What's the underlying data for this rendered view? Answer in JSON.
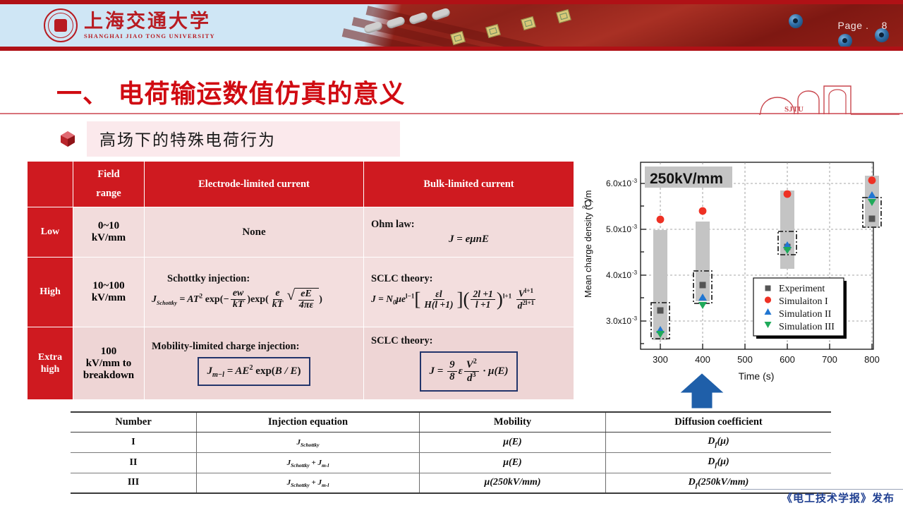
{
  "header": {
    "logo_cn": "上海交通大学",
    "logo_en": "SHANGHAI JIAO TONG UNIVERSITY",
    "page_label": "Page .",
    "page_number": "8",
    "accent_red": "#b01116"
  },
  "title": {
    "heading": "一、 电荷输运数值仿真的意义",
    "subheading": "高场下的特殊电荷行为",
    "arch_word": "SJTU"
  },
  "main_table": {
    "headers": [
      "",
      "Field\nrange",
      "Electrode-limited current",
      "Bulk-limited current"
    ],
    "header_field_line1": "Field",
    "header_field_line2": "range",
    "header_electrode": "Electrode-limited current",
    "header_bulk": "Bulk-limited current",
    "rows": [
      {
        "level": "Low",
        "range": "0~10\nkV/mm",
        "range_line1": "0~10",
        "range_line2": "kV/mm",
        "electrode_caption": "",
        "electrode_text": "None",
        "bulk_caption": "Ohm law:",
        "bulk_formula": "J = eμnE"
      },
      {
        "level": "High",
        "range_line1": "10~100",
        "range_line2": "kV/mm",
        "electrode_caption": "Schottky injection:",
        "electrode_formula": "J_Schottky = AT² exp(−ew/kT) exp((e/kT)√(eE/4πε))",
        "bulk_caption": "SCLC theory:",
        "bulk_formula": "J = N₀μe^(l−1) [ εl / (H(l+1)) ] ( (2l+1)/(l+1) )^(l+1) V^(l+1) / d^(2l+1)"
      },
      {
        "level_line1": "Extra",
        "level_line2": "high",
        "range_line1": "100",
        "range_line2": "kV/mm to",
        "range_line3": "breakdown",
        "electrode_caption": "Mobility-limited charge injection:",
        "electrode_formula": "J_m−l = AE² exp(B / E)",
        "bulk_caption": "SCLC theory:",
        "bulk_formula": "J = (9/8) ε V²/d³ · μ(E)"
      }
    ]
  },
  "bottom_table": {
    "headers": [
      "Number",
      "Injection equation",
      "Mobility",
      "Diffusion coefficient"
    ],
    "rows": [
      {
        "number": "I",
        "injection": "J_Schottky",
        "mobility": "μ(E)",
        "diffusion": "D_f(μ)"
      },
      {
        "number": "II",
        "injection": "J_Schottky + J_m-l",
        "mobility": "μ(E)",
        "diffusion": "D_f(μ)"
      },
      {
        "number": "III",
        "injection": "J_Schottky + J_m-l",
        "mobility": "μ(250kV/mm)",
        "diffusion": "D_f(250kV/mm)"
      }
    ]
  },
  "chart_data": {
    "type": "scatter",
    "title": "",
    "annotation": "250kV/mm",
    "xlabel": "Time (s)",
    "ylabel": "Mean charge density (C/m³)",
    "xlim": [
      250,
      860
    ],
    "ylim": [
      0.0024,
      0.0064
    ],
    "xticks": [
      300,
      400,
      500,
      600,
      700,
      800
    ],
    "xtick_labels": [
      "300",
      "400",
      "500",
      "600",
      "700",
      "800"
    ],
    "yticks": [
      0.003,
      0.004,
      0.005,
      0.006
    ],
    "ytick_labels": [
      "3.0x10-3",
      "4.0x10-3",
      "5.0x10-3",
      "6.0x10-3"
    ],
    "grid": true,
    "legend_position": "lower right",
    "x": [
      300,
      400,
      600,
      800
    ],
    "series": [
      {
        "name": "Experiment",
        "marker": "square",
        "color": "#555555",
        "values": [
          0.00335,
          0.0039,
          0.00473,
          0.00535
        ]
      },
      {
        "name": "Simulaiton I",
        "marker": "circle",
        "color": "#ee3124",
        "values": [
          0.00522,
          0.00541,
          0.00578,
          0.00608
        ]
      },
      {
        "name": "Simulation II",
        "marker": "triangle-up",
        "color": "#2176d2",
        "values": [
          0.0029,
          0.0036,
          0.00474,
          0.00583
        ]
      },
      {
        "name": "Simulation III",
        "marker": "triangle-down",
        "color": "#1faa5a",
        "values": [
          0.00272,
          0.00342,
          0.00459,
          0.00571
        ]
      }
    ],
    "shaded_bands": [
      {
        "x": 300,
        "low": 0.00245,
        "high": 0.00542
      },
      {
        "x": 400,
        "low": 0.00312,
        "high": 0.00561
      },
      {
        "x": 600,
        "low": 0.00427,
        "high": 0.00595
      },
      {
        "x": 800,
        "low": 0.00515,
        "high": 0.00628
      }
    ],
    "dashed_boxes": [
      {
        "x": 300,
        "low": 0.00262,
        "high": 0.00349
      },
      {
        "x": 400,
        "low": 0.00331,
        "high": 0.00402
      },
      {
        "x": 600,
        "low": 0.00448,
        "high": 0.00499
      },
      {
        "x": 800,
        "low": 0.00528,
        "high": 0.00593
      }
    ]
  },
  "footer": {
    "watermark": "《电工技术学报》发布"
  }
}
